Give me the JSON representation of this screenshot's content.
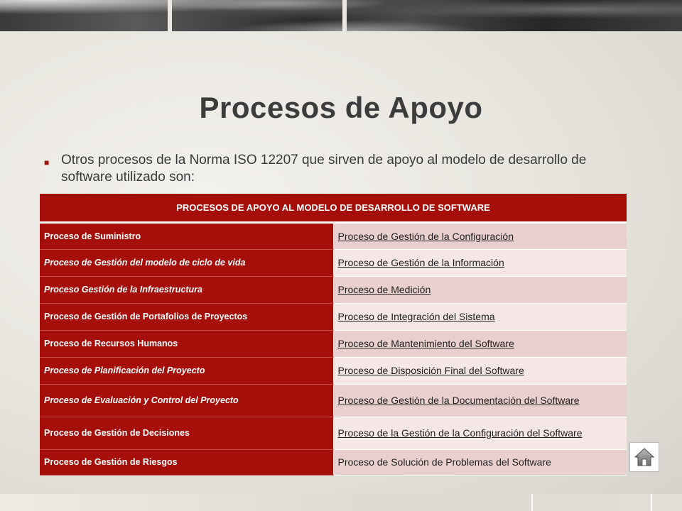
{
  "slide": {
    "title": "Procesos de Apoyo",
    "bullet_text": "Otros procesos de la Norma ISO 12207 que sirven de apoyo al modelo de desarrollo de software utilizado son:"
  },
  "table": {
    "header": "PROCESOS DE APOYO AL MODELO DE DESARROLLO DE SOFTWARE",
    "rows": [
      {
        "left": "Proceso de Suministro",
        "right": "Proceso de Gestión de la Configuración"
      },
      {
        "left": "Proceso de Gestión del modelo de ciclo de vida",
        "right": "Proceso de Gestión de la Información"
      },
      {
        "left": "Proceso Gestión de la Infraestructura",
        "right": "Proceso de Medición"
      },
      {
        "left": "Proceso de Gestión de Portafolios de Proyectos",
        "right": "Proceso de Integración del Sistema"
      },
      {
        "left": "Proceso de Recursos Humanos",
        "right": "Proceso de Mantenimiento del Software"
      },
      {
        "left": "Proceso de Planificación del Proyecto",
        "right": "Proceso de Disposición Final del Software"
      },
      {
        "left": "Proceso de Evaluación y Control del Proyecto",
        "right": "Proceso de Gestión de la Documentación del Software"
      },
      {
        "left": "Proceso de Gestión de Decisiones",
        "right": "Proceso de la Gestión de la Configuración del Software"
      },
      {
        "left": "Proceso de Gestión de Riesgos",
        "right": "Proceso de Solución de Problemas del Software"
      }
    ]
  },
  "icons": {
    "bullet": "square-bullet-icon",
    "home": "home-icon"
  },
  "colors": {
    "accent": "#a60f09",
    "title_text": "#3c3c3c"
  }
}
